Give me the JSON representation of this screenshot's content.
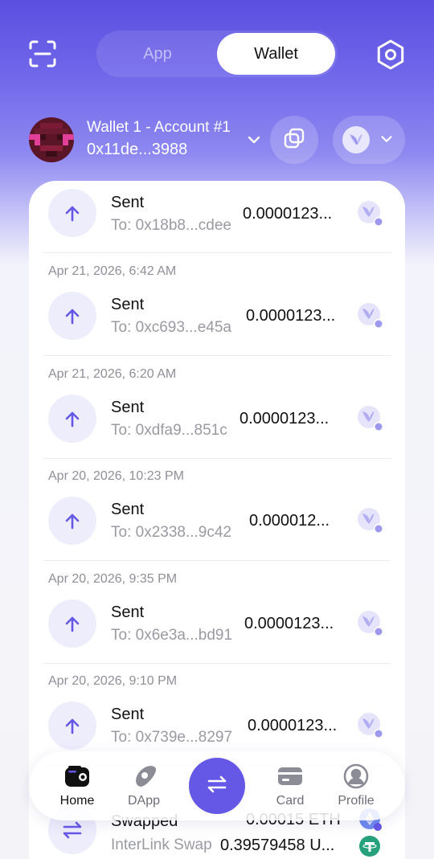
{
  "header": {
    "tabs": [
      {
        "label": "App",
        "active": false
      },
      {
        "label": "Wallet",
        "active": true
      }
    ]
  },
  "account": {
    "name": "Wallet 1 - Account #1",
    "address": "0x11de...3988"
  },
  "transactions": [
    {
      "date": "",
      "title": "Sent",
      "detail": "To: 0x18b8...cdee",
      "amount": "0.0000123...",
      "token_icon": "interlink-token-icon"
    },
    {
      "date": "Apr 21, 2026, 6:42 AM",
      "title": "Sent",
      "detail": "To: 0xc693...e45a",
      "amount": "0.0000123...",
      "token_icon": "interlink-token-icon"
    },
    {
      "date": "Apr 21, 2026, 6:20 AM",
      "title": "Sent",
      "detail": "To: 0xdfa9...851c",
      "amount": "0.0000123...",
      "token_icon": "interlink-token-icon"
    },
    {
      "date": "Apr 20, 2026, 10:23 PM",
      "title": "Sent",
      "detail": "To: 0x2338...9c42",
      "amount": "0.000012...",
      "token_icon": "interlink-token-icon"
    },
    {
      "date": "Apr 20, 2026, 9:35 PM",
      "title": "Sent",
      "detail": "To: 0x6e3a...bd91",
      "amount": "0.0000123...",
      "token_icon": "interlink-token-icon"
    },
    {
      "date": "Apr 20, 2026, 9:10 PM",
      "title": "Sent",
      "detail": "To: 0x739e...8297",
      "amount": "0.0000123...",
      "token_icon": "interlink-token-icon"
    },
    {
      "date": "",
      "title": "Swapped",
      "detail": "InterLink Swap",
      "amount": "0.00015 ETH",
      "amount2": "0.39579458 U...",
      "token_icon": "eth-token-icon"
    }
  ],
  "nav": {
    "items": [
      {
        "label": "Home",
        "icon": "wallet-icon",
        "active": true
      },
      {
        "label": "DApp",
        "icon": "compass-icon",
        "active": false
      },
      {
        "label": "",
        "icon": "swap-icon",
        "active": false
      },
      {
        "label": "Card",
        "icon": "card-icon",
        "active": false
      },
      {
        "label": "Profile",
        "icon": "profile-icon",
        "active": false
      }
    ]
  },
  "colors": {
    "accent": "#6558e6",
    "header_gradient_top": "#5b4fe0",
    "icon_bg": "#eeedfc"
  }
}
